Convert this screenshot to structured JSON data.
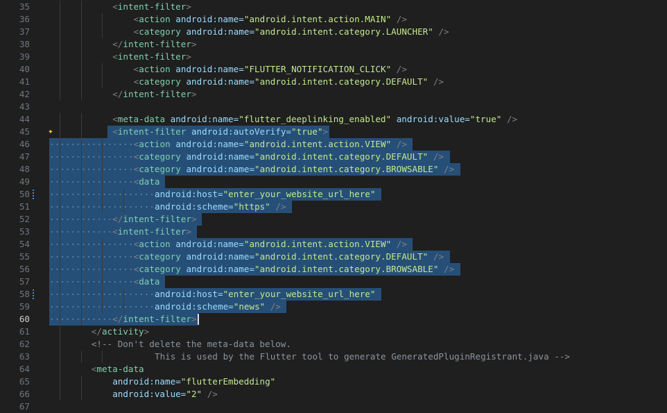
{
  "editor": {
    "lines": [
      {
        "num": "35",
        "text": "<intent-filter>"
      },
      {
        "num": "36",
        "text": "<action android:name=\"android.intent.action.MAIN\" />"
      },
      {
        "num": "37",
        "text": "<category android:name=\"android.intent.category.LAUNCHER\" />"
      },
      {
        "num": "38",
        "text": "</intent-filter>"
      },
      {
        "num": "39",
        "text": "<intent-filter>"
      },
      {
        "num": "40",
        "text": "<action android:name=\"FLUTTER_NOTIFICATION_CLICK\" />"
      },
      {
        "num": "41",
        "text": "<category android:name=\"android.intent.category.DEFAULT\" />"
      },
      {
        "num": "42",
        "text": "</intent-filter>"
      },
      {
        "num": "43",
        "text": ""
      },
      {
        "num": "44",
        "text": "<meta-data android:name=\"flutter_deeplinking_enabled\" android:value=\"true\" />"
      },
      {
        "num": "45",
        "text": "<intent-filter android:autoVerify=\"true\">"
      },
      {
        "num": "46",
        "text": "<action android:name=\"android.intent.action.VIEW\" />"
      },
      {
        "num": "47",
        "text": "<category android:name=\"android.intent.category.DEFAULT\" />"
      },
      {
        "num": "48",
        "text": "<category android:name=\"android.intent.category.BROWSABLE\" />"
      },
      {
        "num": "49",
        "text": "<data"
      },
      {
        "num": "50",
        "text": "android:host=\"enter_your_website_url_here\""
      },
      {
        "num": "51",
        "text": "android:scheme=\"https\" />"
      },
      {
        "num": "52",
        "text": "</intent-filter>"
      },
      {
        "num": "53",
        "text": "<intent-filter>"
      },
      {
        "num": "54",
        "text": "<action android:name=\"android.intent.action.VIEW\" />"
      },
      {
        "num": "55",
        "text": "<category android:name=\"android.intent.category.DEFAULT\" />"
      },
      {
        "num": "56",
        "text": "<category android:name=\"android.intent.category.BROWSABLE\" />"
      },
      {
        "num": "57",
        "text": "<data"
      },
      {
        "num": "58",
        "text": "android:host=\"enter_your_website_url_here\""
      },
      {
        "num": "59",
        "text": "android:scheme=\"news\" />"
      },
      {
        "num": "60",
        "text": "</intent-filter>"
      },
      {
        "num": "61",
        "text": "</activity>"
      },
      {
        "num": "62",
        "text": "<!-- Don't delete the meta-data below."
      },
      {
        "num": "63",
        "text": "This is used by the Flutter tool to generate GeneratedPluginRegistrant.java -->"
      },
      {
        "num": "64",
        "text": "<meta-data"
      },
      {
        "num": "65",
        "text": "android:name=\"flutterEmbedding\""
      },
      {
        "num": "66",
        "text": "android:value=\"2\" />"
      },
      {
        "num": "67",
        "text": ""
      }
    ],
    "active_line": "60",
    "icons": {
      "ai_sparkle": "sparkle-icon",
      "modified_marker": "diff-modified-icon"
    },
    "colors": {
      "background": "#1f1f1f",
      "selection": "#264f78",
      "line_number": "#6e7681",
      "active_line_number": "#cccccc",
      "sparkle": "#f0c233"
    }
  }
}
